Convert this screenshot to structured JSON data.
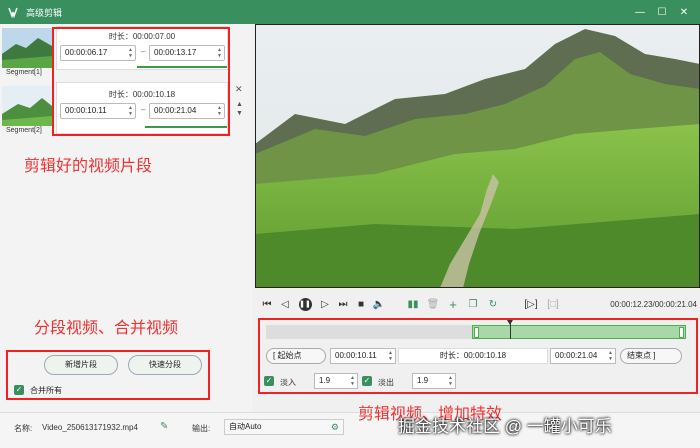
{
  "window": {
    "title": "高级剪辑",
    "min_icon": "minimize-icon",
    "max_icon": "maximize-icon",
    "close_icon": "close-icon"
  },
  "segments": [
    {
      "label": "Segment[1]",
      "duration_label": "时长：00:00:07.00",
      "start": "00:00:06.17",
      "end": "00:00:13.17"
    },
    {
      "label": "Segment[2]",
      "duration_label": "时长：00:00:10.18",
      "start": "00:00:10.11",
      "end": "00:00:21.04"
    }
  ],
  "annotations": {
    "segments_note": "剪辑好的视频片段",
    "split_merge_note": "分段视频、合并视频",
    "edit_note": "剪辑视频、增加特效"
  },
  "left_actions": {
    "add_segment": "新增片段",
    "quick_split": "快速分段",
    "merge_all": "合并所有"
  },
  "player": {
    "time_display": "00:00:12.23/00:00:21.04"
  },
  "editor": {
    "start_button": "[ 起始点",
    "start_time": "00:00:10.11",
    "duration_label": "时长：00:00:10.18",
    "end_time": "00:00:21.04",
    "end_button": "结束点 ]",
    "fade_in_label": "淡入",
    "fade_in_value": "1.9",
    "fade_out_label": "淡出",
    "fade_out_value": "1.9",
    "selection_start": 0.49,
    "selection_end": 1.0,
    "playhead": 0.58
  },
  "bottom": {
    "name_label": "名称:",
    "file_name": "Video_250613171932.mp4",
    "output_label": "输出:",
    "output_value": "自动Auto"
  },
  "watermark": "掘金技术社区 @ 一罐小可乐",
  "colors": {
    "accent": "#3a8f5f",
    "annotation": "#e22222"
  }
}
